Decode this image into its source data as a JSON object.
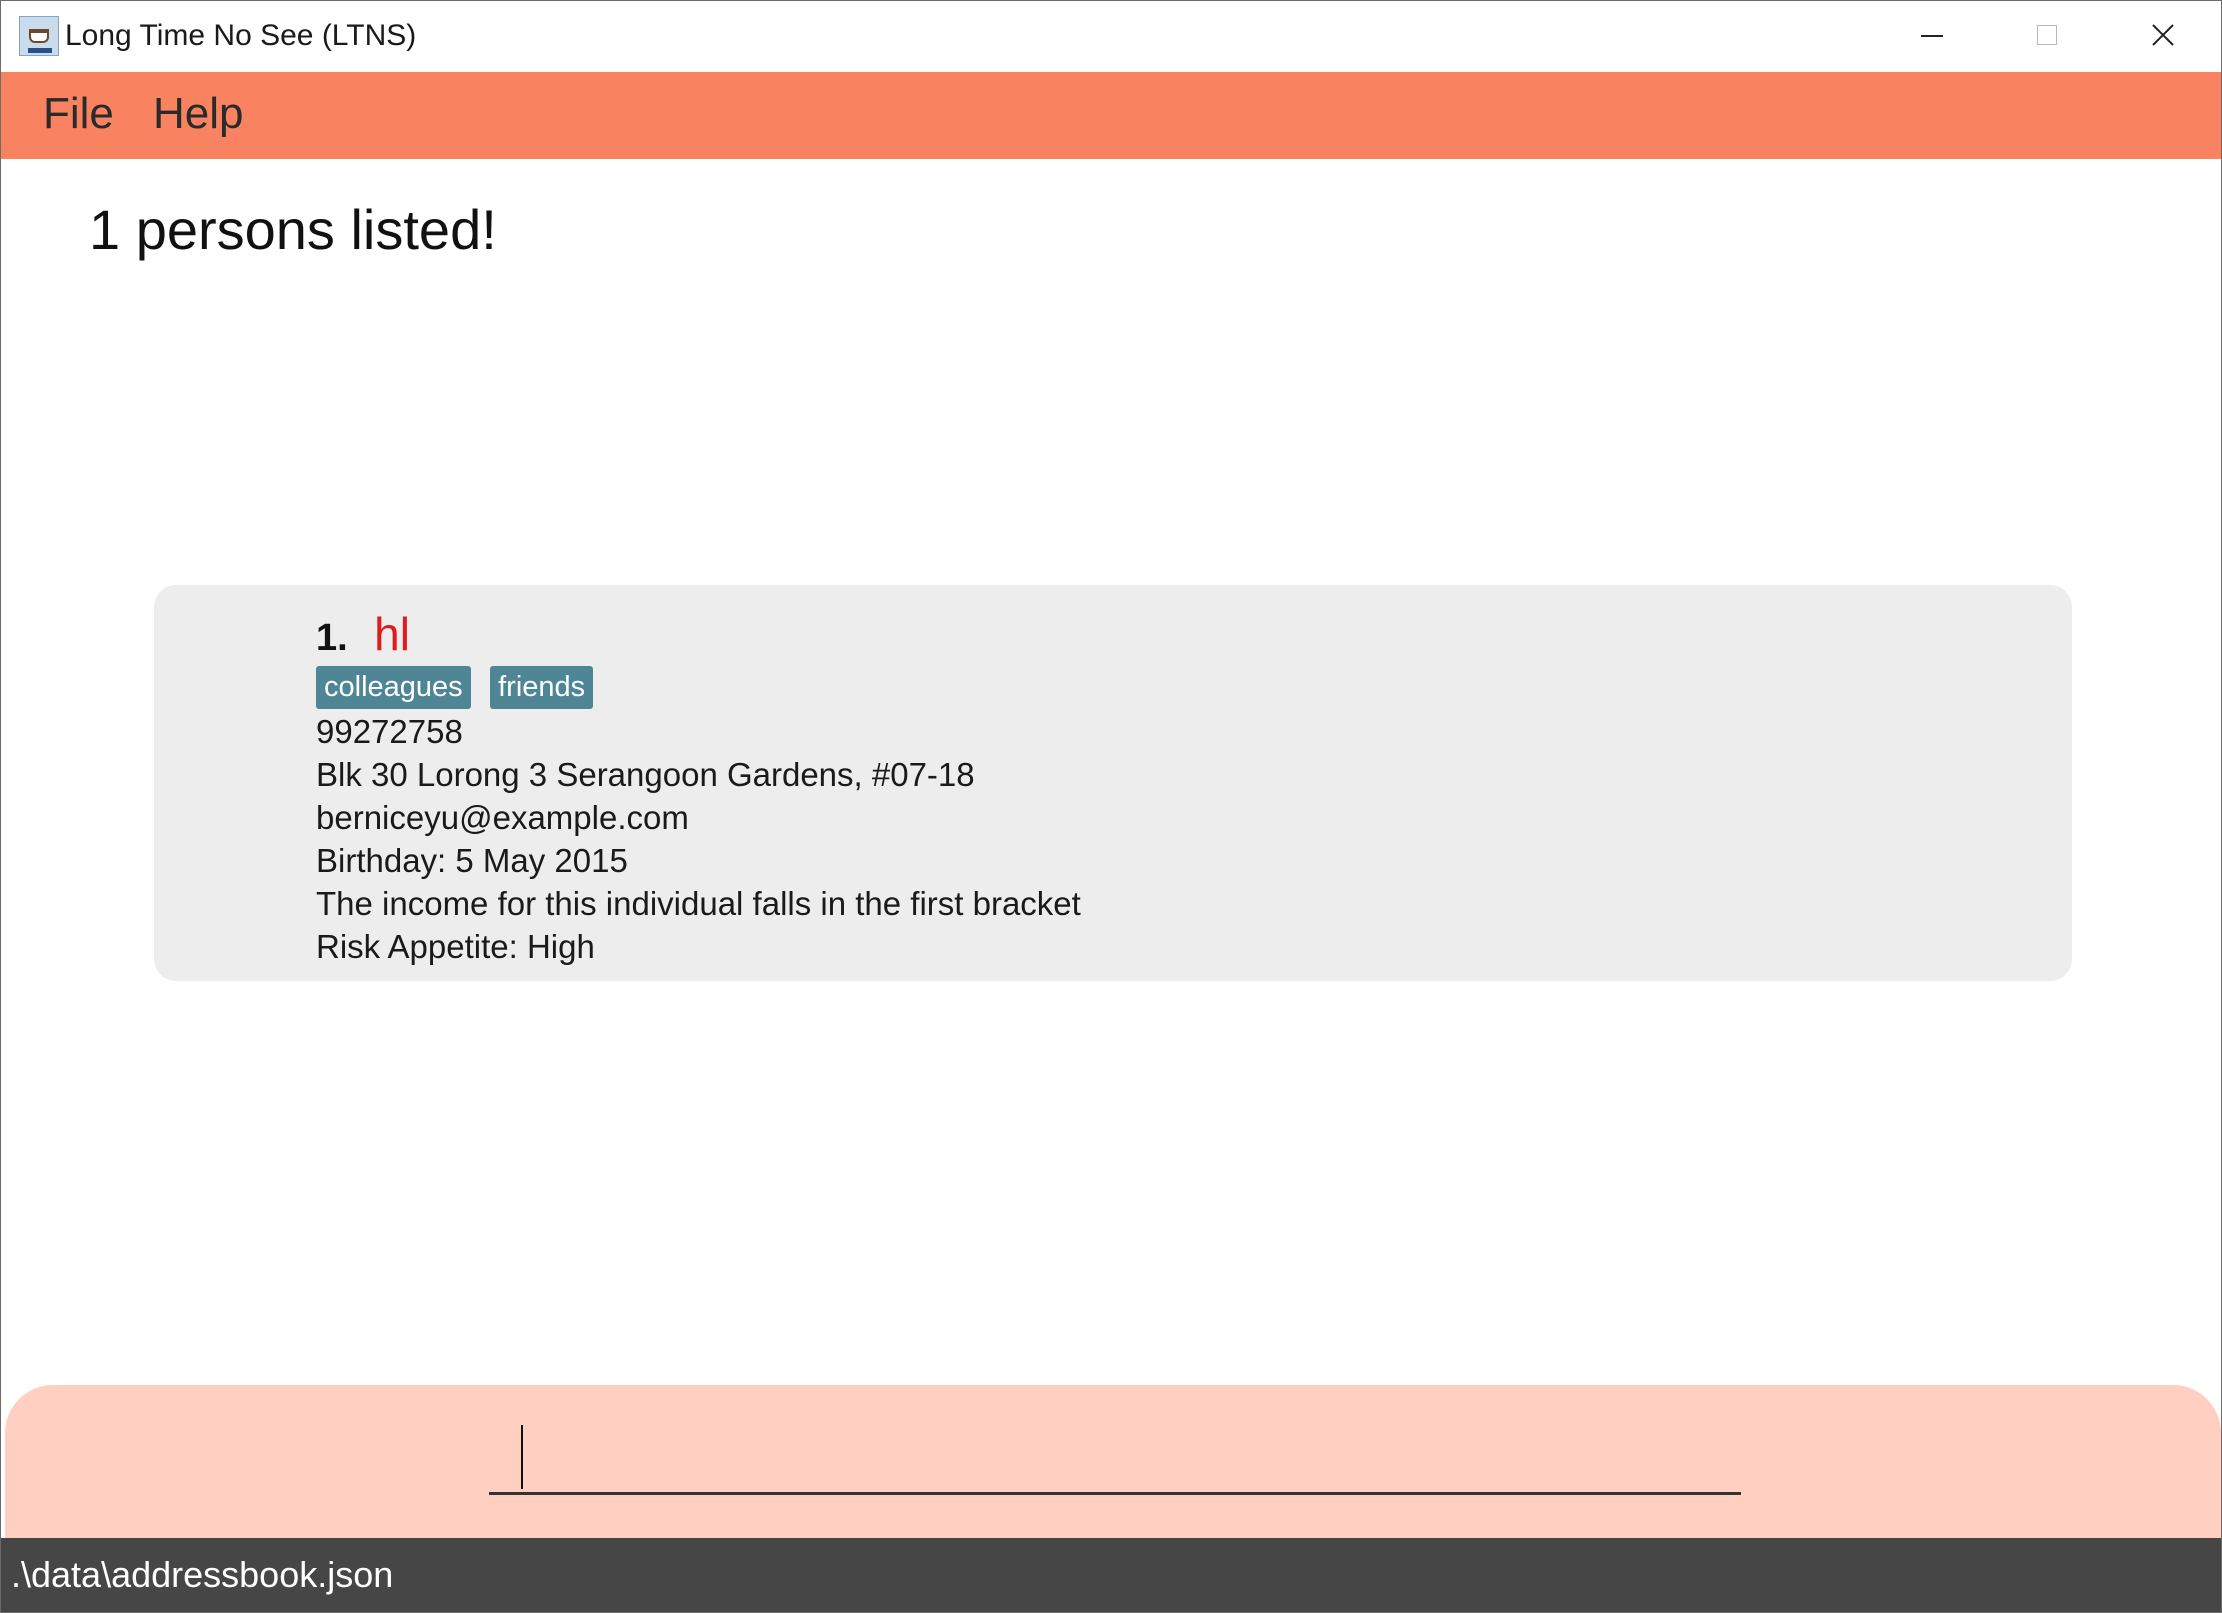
{
  "window": {
    "title": "Long Time No See (LTNS)"
  },
  "menu": {
    "file_label": "File",
    "help_label": "Help"
  },
  "result": {
    "message": "1 persons listed!"
  },
  "persons": [
    {
      "index": "1.",
      "name": "hl",
      "tags": [
        "colleagues",
        "friends"
      ],
      "phone": "99272758",
      "address": "Blk 30 Lorong 3 Serangoon Gardens, #07-18",
      "email": "berniceyu@example.com",
      "birthday": "Birthday: 5 May 2015",
      "income": "The income for this individual falls in the first bracket",
      "risk_appetite": "Risk Appetite: High"
    }
  ],
  "command": {
    "value": ""
  },
  "status": {
    "file_path": ".\\data\\addressbook.json"
  },
  "colors": {
    "menu_bar": "#f98361",
    "command_area": "#ffcfc2",
    "status_bar": "#464646",
    "tag": "#4f8696",
    "name": "#e01b1b",
    "card": "#ededed"
  },
  "icons": {
    "app": "ltns-app-icon",
    "minimize": "minimize-icon",
    "maximize": "maximize-icon",
    "close": "close-icon"
  }
}
